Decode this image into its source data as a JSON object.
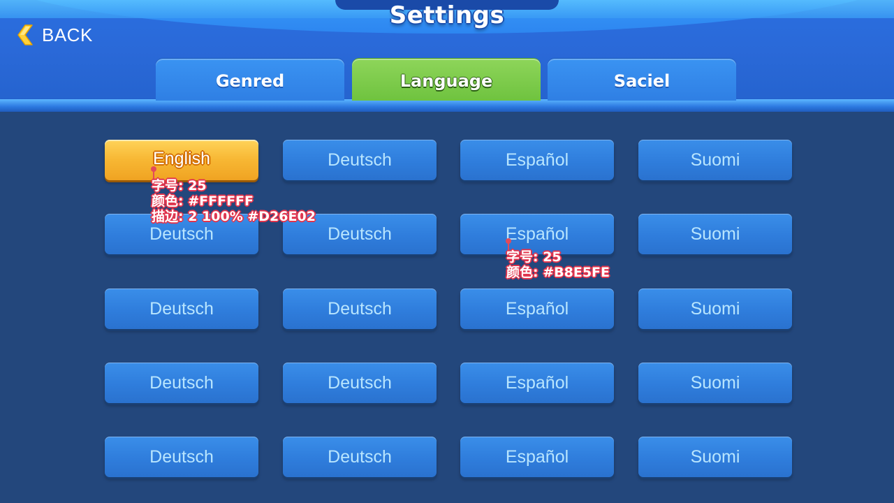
{
  "header": {
    "title": "Settings",
    "back_label": "BACK"
  },
  "tabs": [
    {
      "label": "Genred",
      "active": false
    },
    {
      "label": "Language",
      "active": true
    },
    {
      "label": "Saciel",
      "active": false
    }
  ],
  "language_grid": {
    "selected": "English",
    "rows": [
      [
        "English",
        "Deutsch",
        "Español",
        "Suomi"
      ],
      [
        "Deutsch",
        "Deutsch",
        "Español",
        "Suomi"
      ],
      [
        "Deutsch",
        "Deutsch",
        "Español",
        "Suomi"
      ],
      [
        "Deutsch",
        "Deutsch",
        "Español",
        "Suomi"
      ],
      [
        "Deutsch",
        "Deutsch",
        "Español",
        "Suomi"
      ]
    ]
  },
  "annotations": {
    "selected_style": {
      "lines": [
        "字号: 25",
        "颜色: #FFFFFF",
        "描边: 2 100% #D26E02"
      ]
    },
    "normal_style": {
      "lines": [
        "字号: 25",
        "颜色: #B8E5FE"
      ]
    }
  },
  "colors": {
    "background": "#23477c",
    "tab_active": "#7cc94a",
    "tab_inactive": "#348aed",
    "button_normal": "#2f7ddc",
    "button_selected": "#f7b733",
    "label_normal": "#B8E5FE",
    "label_selected": "#FFFFFF",
    "label_selected_stroke": "#D26E02",
    "annotation": "#E3344C"
  },
  "icons": {
    "back": "chevron-left-icon"
  }
}
